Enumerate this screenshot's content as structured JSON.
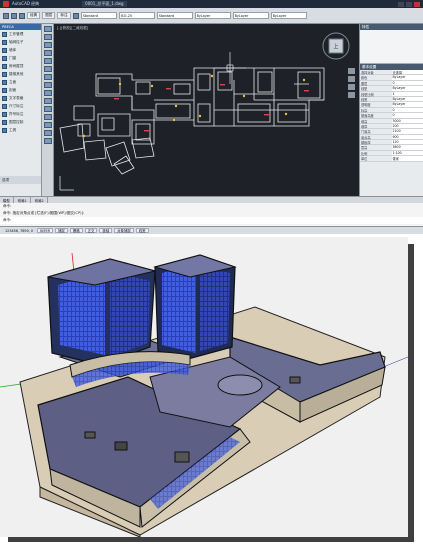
{
  "window": {
    "title": "AutoCAD  经典",
    "file_tab": "0001_总平面_1.dwg"
  },
  "ribbon": {
    "tabs": [
      "经典",
      "图层",
      "标注"
    ],
    "dropdowns": [
      "Standard",
      "ISO-25",
      "Standard",
      "ByLayer",
      "ByLayer",
      "ByLayer"
    ]
  },
  "left_panel": {
    "header": "PBECA",
    "items": [
      "工作管理",
      "轴网柱子",
      "墙体",
      "门窗",
      "房间屋顶",
      "楼梯其他",
      "立面",
      "剖面",
      "文字表格",
      "尺寸标注",
      "符号标注",
      "图层控制",
      "工具"
    ],
    "footer": "选项"
  },
  "drawing": {
    "label": "[-][俯视][二维线框]",
    "viewcube_label": "上"
  },
  "right_panel": {
    "header1": "特性",
    "header2": "基本设置",
    "rows": [
      {
        "k": "选择对象",
        "v": "无选择"
      },
      {
        "k": "颜色",
        "v": "ByLayer"
      },
      {
        "k": "图层",
        "v": "0"
      },
      {
        "k": "线型",
        "v": "ByLayer"
      },
      {
        "k": "线型比例",
        "v": "1"
      },
      {
        "k": "线宽",
        "v": "ByLayer"
      },
      {
        "k": "透明度",
        "v": "ByLayer"
      },
      {
        "k": "标高",
        "v": "0"
      },
      {
        "k": "基面高度",
        "v": "0"
      },
      {
        "k": "墙高",
        "v": "3000"
      },
      {
        "k": "墙厚",
        "v": "200"
      },
      {
        "k": "门窗高",
        "v": "2100"
      },
      {
        "k": "窗台高",
        "v": "900"
      },
      {
        "k": "楼板厚",
        "v": "120"
      },
      {
        "k": "层高",
        "v": "3600"
      },
      {
        "k": "比例",
        "v": "1:100"
      },
      {
        "k": "单位",
        "v": "毫米"
      }
    ]
  },
  "command": {
    "tabs": [
      "模型",
      "布局1",
      "布局2"
    ],
    "lines": [
      "命令:",
      "命令: 指定对角点或 [栏选(F)/圈围(WP)/圈交(CP)]:",
      "命令:"
    ]
  },
  "status": {
    "coords": "123456, 7890, 0",
    "items": [
      "INFER",
      "捕捉",
      "栅格",
      "正交",
      "极轴",
      "对象捕捉",
      "线宽"
    ]
  },
  "model": {}
}
